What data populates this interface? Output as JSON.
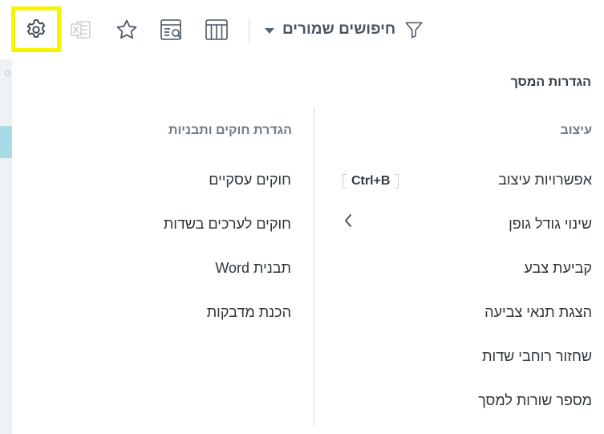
{
  "toolbar": {
    "saved_searches_label": "חיפושים שמורים",
    "icons": [
      "gear-icon",
      "excel-icon",
      "star-icon",
      "report-search-icon",
      "columns-icon",
      "filter-icon"
    ],
    "highlight_color": "#f5f500"
  },
  "menu": {
    "title": "הגדרות המסך",
    "right_section": {
      "header": "עיצוב",
      "items": [
        "אפשרויות עיצוב",
        "שינוי גודל גופן",
        "קביעת צבע",
        "הצגת תנאי צביעה",
        "שחזור רוחבי שדות",
        "מספר שורות למסך"
      ],
      "shortcut": "Ctrl+B"
    },
    "left_section": {
      "header": "הגדרת חוקים ותבניות",
      "items": [
        "חוקים עסקיים",
        "חוקים לערכים בשדות",
        "תבנית Word",
        "הכנת מדבקות"
      ]
    }
  }
}
